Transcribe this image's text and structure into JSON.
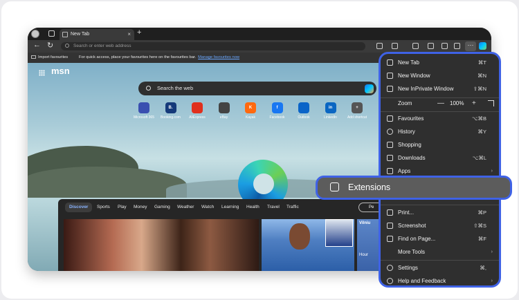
{
  "browser": {
    "tab_title": "New Tab",
    "tab_close": "×",
    "new_tab_symbol": "+",
    "back_symbol": "←",
    "refresh_symbol": "↻",
    "address_placeholder": "Search or enter web address",
    "more_symbol": "···",
    "favbar": {
      "import_label": "Import favourites",
      "message": "For quick access, place your favourites here on the favourites bar.",
      "link_label": "Manage favourites now"
    }
  },
  "newtab": {
    "logo": "msn",
    "search_placeholder": "Search the web",
    "shortcuts": [
      {
        "label": "Microsoft 365",
        "glyph": "",
        "color": "#3a4fb0"
      },
      {
        "label": "Booking.com",
        "glyph": "B.",
        "color": "#153a7a"
      },
      {
        "label": "AliExpress",
        "glyph": "",
        "color": "#e0301e"
      },
      {
        "label": "eBay",
        "glyph": "",
        "color": "#444444"
      },
      {
        "label": "Kayak",
        "glyph": "K",
        "color": "#ff690f"
      },
      {
        "label": "Facebook",
        "glyph": "f",
        "color": "#1877f2"
      },
      {
        "label": "Outlook",
        "glyph": "",
        "color": "#0a64c8"
      },
      {
        "label": "LinkedIn",
        "glyph": "in",
        "color": "#0a66c2"
      },
      {
        "label": "Add shortcut",
        "glyph": "+",
        "color": "#555555"
      }
    ],
    "feed_tabs": [
      "Discover",
      "Sports",
      "Play",
      "Money",
      "Gaming",
      "Weather",
      "Watch",
      "Learning",
      "Health",
      "Travel",
      "Traffic"
    ],
    "personalize_label": "Pe",
    "weather_city": "Vilniu",
    "weather_sub": "Hour"
  },
  "menu": {
    "new_tab": {
      "label": "New Tab",
      "shortcut": "⌘T"
    },
    "new_window": {
      "label": "New Window",
      "shortcut": "⌘N"
    },
    "new_inprivate": {
      "label": "New InPrivate Window",
      "shortcut": "⇧⌘N"
    },
    "zoom": {
      "label": "Zoom",
      "minus": "—",
      "value": "100%",
      "plus": "+"
    },
    "favourites": {
      "label": "Favourites",
      "shortcut": "⌥⌘B"
    },
    "history": {
      "label": "History",
      "shortcut": "⌘Y"
    },
    "shopping": {
      "label": "Shopping"
    },
    "downloads": {
      "label": "Downloads",
      "shortcut": "⌥⌘L"
    },
    "apps": {
      "label": "Apps",
      "arrow": "›"
    },
    "extensions": {
      "label": "Extensions"
    },
    "print": {
      "label": "Print...",
      "shortcut": "⌘P"
    },
    "screenshot": {
      "label": "Screenshot",
      "shortcut": "⇧⌘S"
    },
    "find_on_page": {
      "label": "Find on Page...",
      "shortcut": "⌘F"
    },
    "more_tools": {
      "label": "More Tools",
      "arrow": "›"
    },
    "settings": {
      "label": "Settings",
      "shortcut": "⌘,"
    },
    "help": {
      "label": "Help and Feedback",
      "arrow": "›"
    }
  },
  "colors": {
    "highlight_border": "#3f62e6",
    "menu_bg": "#2f2f2f"
  }
}
